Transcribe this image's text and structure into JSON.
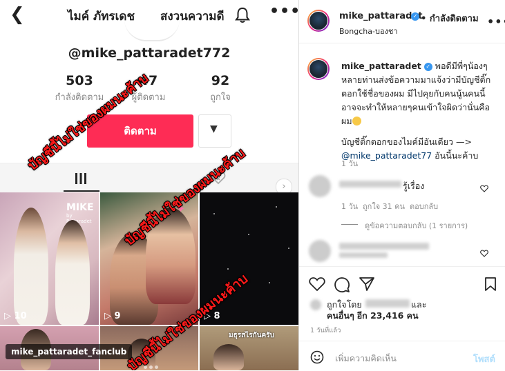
{
  "tiktok": {
    "back_icon": "chevron-left-icon",
    "name": "ไมค์ ภัทรเดช",
    "title_right": "สงวนความดี",
    "handle": "@mike_pattaradet772",
    "stats": [
      {
        "value": "503",
        "label": "กำลังติดตาม"
      },
      {
        "value": "47",
        "label": "ผู้ติดตาม"
      },
      {
        "value": "92",
        "label": "ถูกใจ"
      }
    ],
    "follow_label": "ติดตาม",
    "overlay_text": "บัญชีนี้ไม่ใช่ของผมนะค้าบ",
    "videos": [
      {
        "plays": "10"
      },
      {
        "plays": "9"
      },
      {
        "plays": "8"
      }
    ],
    "thumb_brand": "MIKE",
    "thumb_brand_sub": "by Pattaradet",
    "thumb6_text": "มธุรสไรกันครับ",
    "fanclub_label": "mike_pattaradet_fanclub"
  },
  "instagram": {
    "header": {
      "username": "mike_pattaradet",
      "follow_state": "• กำลังติดตาม",
      "location": "Bongcha-บองชา"
    },
    "caption": {
      "username": "mike_pattaradet",
      "text_1": "พอดีมีพี่ๆน้องๆหลายท่านส่งข้อความมาแจ้งว่ามีบัญชีติ๊กตอกใช้ชื่อของผม มีไปคุยกับคนนู้นคนนี้ อาจจะทำให้หลายๆคนเข้าใจผิดว่านั่นคือผม",
      "text_2": "บัญชีติ๊กตอกของไมค์มีอันเดียว —>",
      "mention": "@mike_pattaradet77",
      "text_3": " อันนี้นะค้าบ",
      "time": "1 วัน"
    },
    "comment1": {
      "text": "รู้เรื่อง",
      "time": "1 วัน",
      "likes": "ถูกใจ 31 คน",
      "reply": "ตอบกลับ"
    },
    "view_replies": "ดูข้อความตอบกลับ (1 รายการ)",
    "likes_line_1": "ถูกใจโดย",
    "likes_and": "และ",
    "likes_line_2a": "คนอื่นๆ",
    "likes_line_2b": "อีก 23,416 คน",
    "posted_ago": "1 วันที่แล้ว",
    "add_comment_placeholder": "เพิ่มความคิดเห็น",
    "post_label": "โพสต์"
  },
  "colors": {
    "tiktok_red": "#fe2c55",
    "verified_blue": "#3897f0",
    "overlay_red": "#ff1a1a",
    "post_disabled": "#b2dffc"
  }
}
